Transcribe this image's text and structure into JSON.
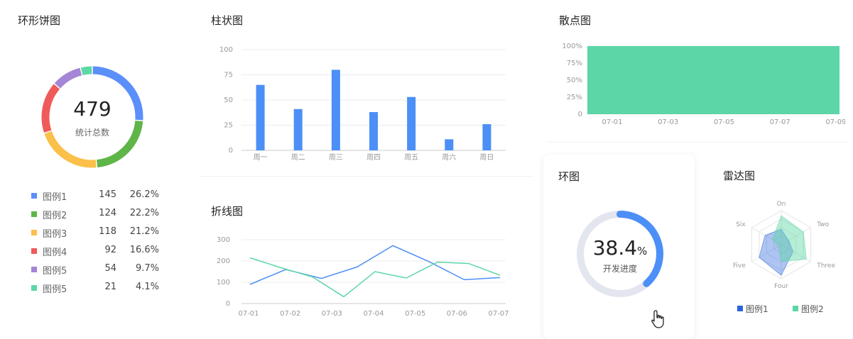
{
  "donut": {
    "title": "环形饼图",
    "total": "479",
    "total_label": "统计总数",
    "legend": [
      {
        "name": "图例1",
        "value": "145",
        "percent": "26.2%",
        "color": "#5b8ff9"
      },
      {
        "name": "图例2",
        "value": "124",
        "percent": "22.2%",
        "color": "#5fb548"
      },
      {
        "name": "图例3",
        "value": "118",
        "percent": "21.2%",
        "color": "#fbc04a"
      },
      {
        "name": "图例4",
        "value": "92",
        "percent": "16.6%",
        "color": "#f05a5a"
      },
      {
        "name": "图例5",
        "value": "54",
        "percent": "9.7%",
        "color": "#a585d6"
      },
      {
        "name": "图例5",
        "value": "21",
        "percent": "4.1%",
        "color": "#5ed8a6"
      }
    ]
  },
  "bar": {
    "title": "柱状图"
  },
  "line": {
    "title": "折线图"
  },
  "scatter": {
    "title": "散点图"
  },
  "ring": {
    "title": "环图",
    "value": "38.4",
    "unit": "%",
    "label": "开发进度"
  },
  "radar": {
    "title": "雷达图"
  },
  "colors": {
    "blue": "#4c8ff7",
    "green": "#5cd6a6",
    "ring_track": "#e3e6ef"
  },
  "chart_data": [
    {
      "type": "pie",
      "title": "环形饼图",
      "categories": [
        "图例1",
        "图例2",
        "图例3",
        "图例4",
        "图例5",
        "图例5"
      ],
      "values": [
        145,
        124,
        118,
        92,
        54,
        21
      ]
    },
    {
      "type": "bar",
      "title": "柱状图",
      "categories": [
        "周一",
        "周二",
        "周三",
        "周四",
        "周五",
        "周六",
        "周日"
      ],
      "values": [
        65,
        41,
        80,
        38,
        53,
        11,
        26
      ],
      "ylim": [
        0,
        100
      ],
      "yticks": [
        0,
        25,
        50,
        75,
        100
      ]
    },
    {
      "type": "line",
      "title": "折线图",
      "x": [
        "07-01",
        "07-02",
        "07-03",
        "07-04",
        "07-05",
        "07-06",
        "07-07"
      ],
      "series": [
        {
          "values": [
            90,
            160,
            118,
            172,
            272,
            198,
            112,
            122
          ]
        },
        {
          "values": [
            215,
            168,
            125,
            32,
            150,
            120,
            195,
            188,
            133
          ]
        }
      ],
      "ylim": [
        0,
        300
      ],
      "yticks": [
        0,
        100,
        200,
        300
      ]
    },
    {
      "type": "area",
      "title": "散点图",
      "x": [
        "07-01",
        "07-03",
        "07-05",
        "07-07",
        "07-09"
      ],
      "values": [
        100,
        100,
        100,
        100,
        100
      ],
      "ylim": [
        0,
        100
      ],
      "ytick_labels": [
        "0",
        "25%",
        "50%",
        "75%",
        "100%"
      ]
    },
    {
      "type": "pie",
      "title": "环图",
      "values": [
        38.4
      ],
      "max": 100
    },
    {
      "type": "radar",
      "title": "雷达图",
      "axes": [
        "On",
        "Two",
        "Three",
        "Four",
        "Five",
        "Six"
      ],
      "series": [
        {
          "name": "图例1",
          "values": [
            45,
            25,
            40,
            90,
            75,
            55
          ]
        },
        {
          "name": "图例2",
          "values": [
            85,
            75,
            85,
            50,
            10,
            30
          ]
        }
      ],
      "legend": [
        "图例1",
        "图例2"
      ]
    }
  ]
}
